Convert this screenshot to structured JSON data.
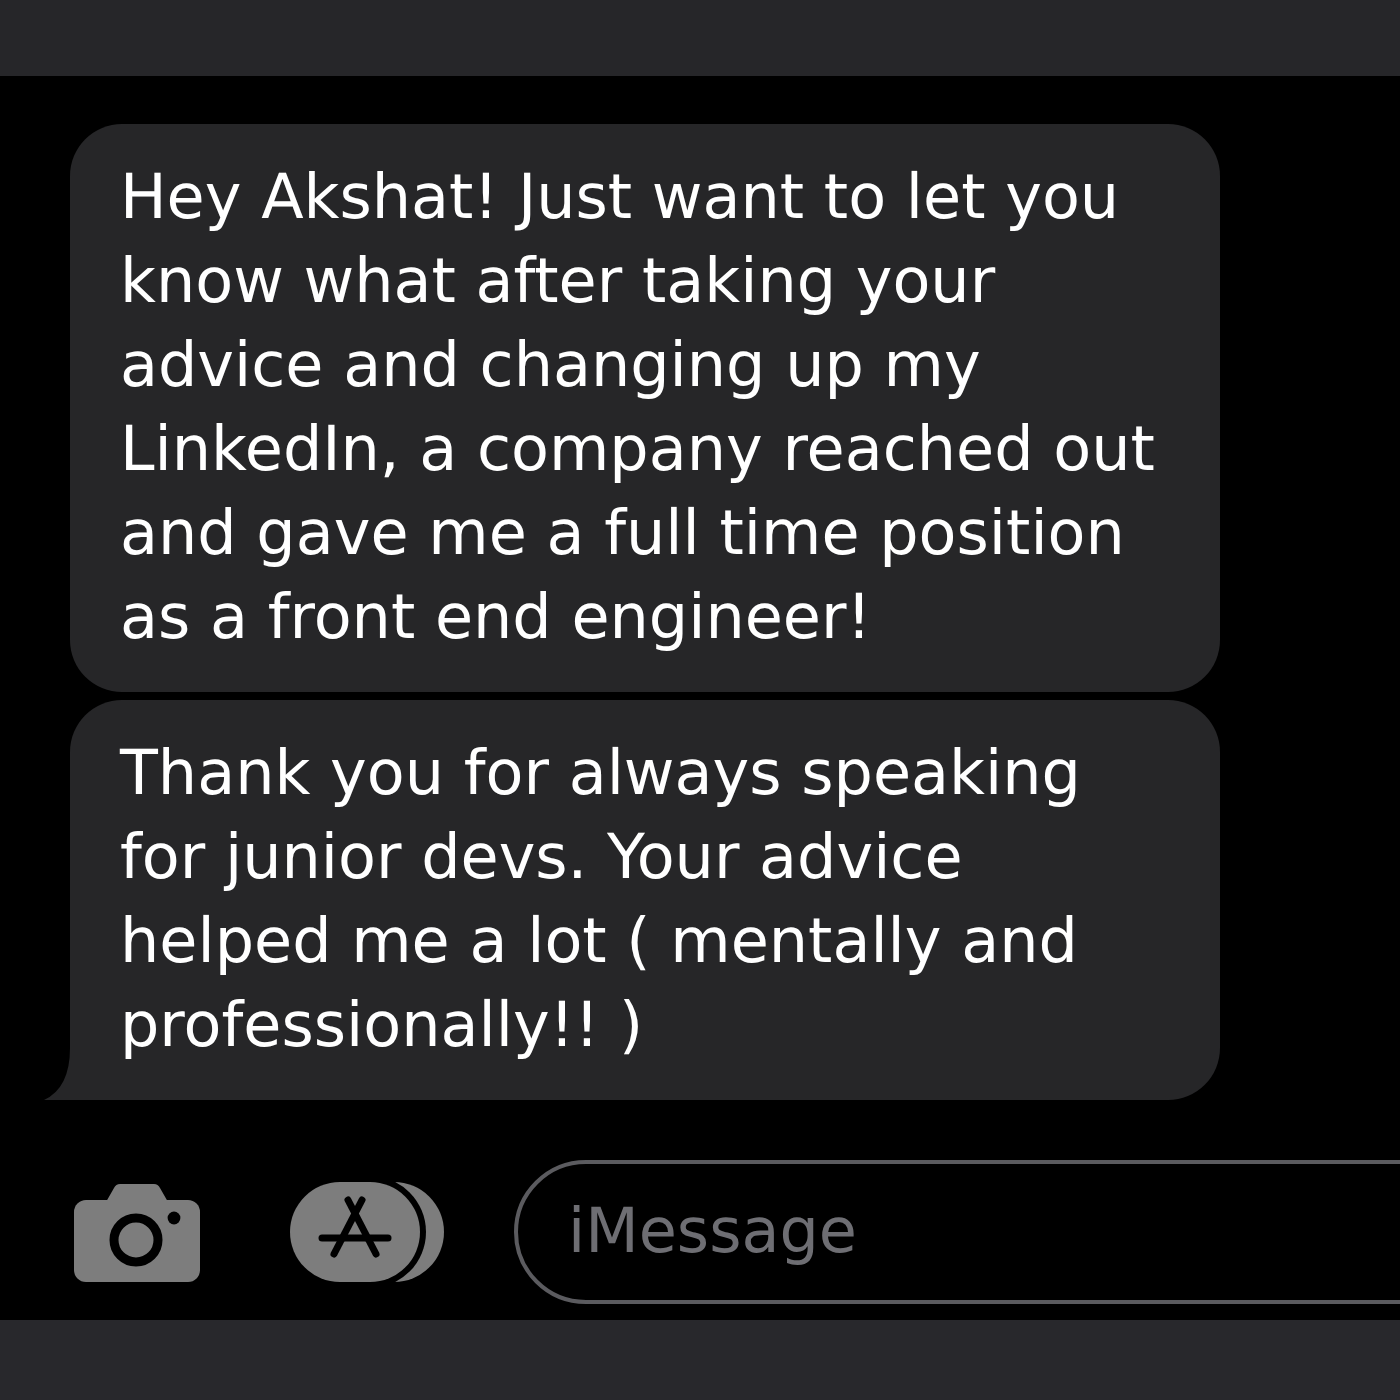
{
  "messages": [
    {
      "text": "Hey Akshat! Just want to let you know what after taking your advice and changing up my LinkedIn, a company reached out and gave me a full time position as a front end engineer!",
      "tail": false
    },
    {
      "text": "Thank you for always speaking for junior devs. Your advice helped me a lot ( mentally and professionally!! )",
      "tail": true
    }
  ],
  "composer": {
    "placeholder": "iMessage"
  }
}
